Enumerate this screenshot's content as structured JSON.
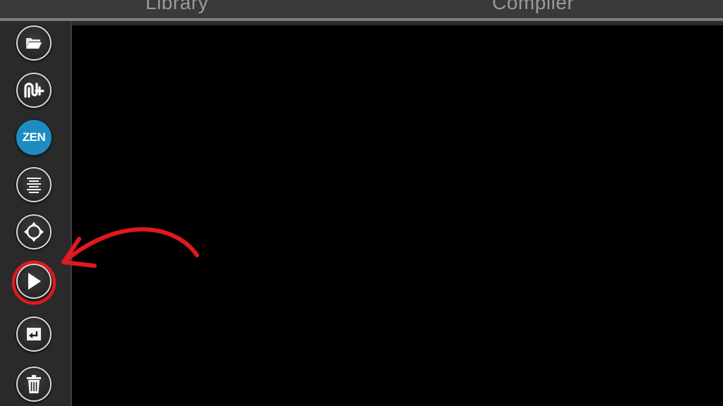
{
  "tabs": [
    {
      "label": "Library"
    },
    {
      "label": "Compiler"
    }
  ],
  "toolbar": {
    "zen_label": "ZEN",
    "buttons": [
      {
        "name": "open-folder-button",
        "icon": "folder-open-icon"
      },
      {
        "name": "add-chip-button",
        "icon": "chip-add-icon"
      },
      {
        "name": "zen-button",
        "icon": "zen-icon"
      },
      {
        "name": "align-button",
        "icon": "align-center-icon"
      },
      {
        "name": "refresh-button",
        "icon": "rotate-target-icon"
      },
      {
        "name": "run-button",
        "icon": "play-icon"
      },
      {
        "name": "return-button",
        "icon": "return-icon"
      },
      {
        "name": "delete-button",
        "icon": "trash-icon"
      }
    ]
  },
  "colors": {
    "zen_accent": "#1e8bc3",
    "annotation": "#e0191f",
    "canvas": "#000000"
  }
}
